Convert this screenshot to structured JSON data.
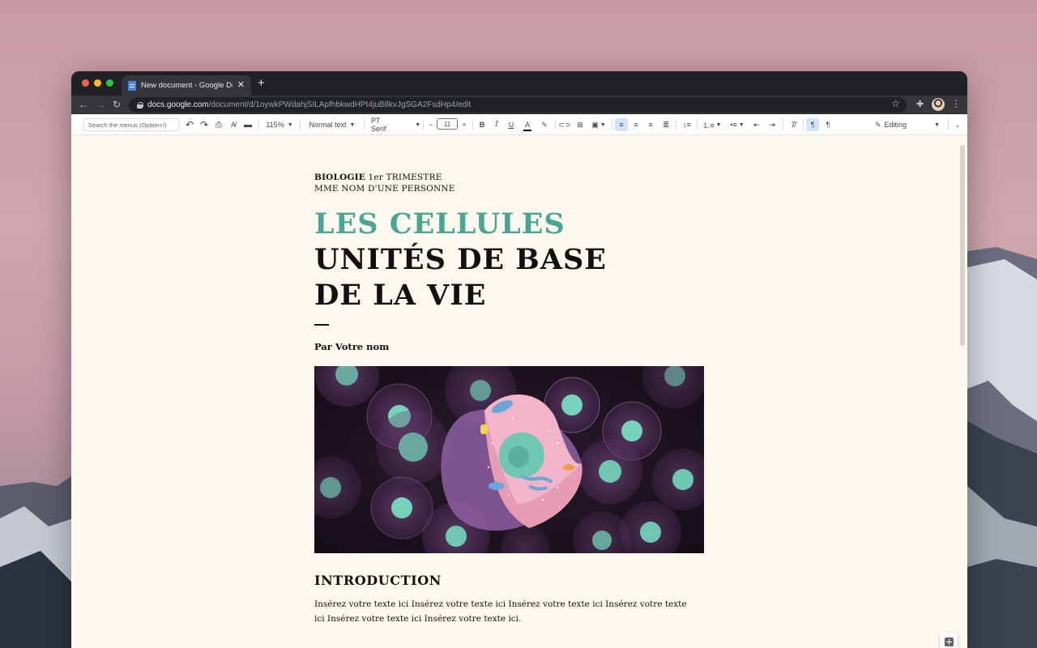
{
  "browser": {
    "tab_title": "New document - Google Docs",
    "url_host": "docs.google.com",
    "url_path": "/document/d/1oywkPWdahjSILApfhbkwdHPt4juB8kvJgSGA2FsdHp4/edit"
  },
  "toolbar": {
    "search_placeholder": "Search the menus (Option+/)",
    "zoom": "115%",
    "style": "Normal text",
    "font": "PT Serif",
    "font_size": "11",
    "mode": "Editing"
  },
  "document": {
    "subject": "BIOLOGIE",
    "term": " 1er TRIMESTRE",
    "teacher": "MME NOM D'UNE PERSONNE",
    "title_accent": "LES CELLULES",
    "title_line2": "UNITÉS DE BASE",
    "title_line3": "DE LA VIE",
    "author": "Par Votre nom",
    "intro_heading": "INTRODUCTION",
    "intro_body": "Insérez votre texte ici Insérez votre texte ici Insérez votre texte ici Insérez votre texte ici Insérez votre texte ici Insérez votre texte ici."
  },
  "colors": {
    "accent": "#4aa595",
    "page_bg": "#fcf8ee"
  },
  "icons": [
    "undo-icon",
    "redo-icon",
    "print-icon",
    "spellcheck-icon",
    "paint-format-icon",
    "bold-icon",
    "italic-icon",
    "underline-icon",
    "text-color-icon",
    "highlight-icon",
    "link-icon",
    "comment-icon",
    "image-icon",
    "align-left-icon",
    "align-center-icon",
    "align-right-icon",
    "justify-icon",
    "line-spacing-icon",
    "numbered-list-icon",
    "bulleted-list-icon",
    "decrease-indent-icon",
    "increase-indent-icon",
    "clear-formatting-icon",
    "ltr-icon",
    "rtl-icon",
    "pencil-icon"
  ]
}
